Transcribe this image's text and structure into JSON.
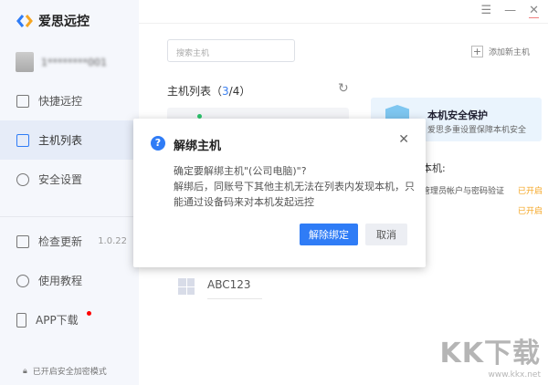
{
  "app": {
    "title": "爱思远控"
  },
  "user": {
    "name": "1********001"
  },
  "window": {
    "menu_icon": "☰",
    "min_icon": "—",
    "close_icon": "✕"
  },
  "sidebar": {
    "items": [
      {
        "label": "快捷远控",
        "icon": "monitor-icon"
      },
      {
        "label": "主机列表",
        "icon": "list-icon",
        "active": true
      },
      {
        "label": "安全设置",
        "icon": "shield-icon"
      },
      {
        "label": "检查更新",
        "icon": "upload-icon",
        "extra": "1.0.22"
      },
      {
        "label": "使用教程",
        "icon": "help-icon"
      },
      {
        "label": "APP下载",
        "icon": "phone-icon",
        "badge": true
      }
    ],
    "footer": "已开启安全加密模式"
  },
  "main": {
    "search_placeholder": "搜索主机",
    "add_host": "添加新主机",
    "list_title": "主机列表（",
    "list_count": "3",
    "list_total": "/4）",
    "hosts": [
      {
        "name": "ABC123"
      }
    ]
  },
  "security": {
    "title": "本机安全保护",
    "subtitle": "爱思多重设置保障本机安全",
    "section": "本机:",
    "item1": "管理员帐户与密码验证",
    "status1": "已开启",
    "status2": "已开启"
  },
  "dialog": {
    "title": "解绑主机",
    "line1": "确定要解绑主机\"(公司电脑)\"?",
    "line2": "解绑后，同账号下其他主机无法在列表内发现本机，只能通过设备码来对本机发起远控",
    "confirm": "解除绑定",
    "cancel": "取消"
  },
  "watermark": {
    "text": "KK下载",
    "url": "www.kkx.net"
  },
  "colors": {
    "accent": "#2f7cf6",
    "warning": "#f5a623",
    "online": "#2bc36b"
  }
}
